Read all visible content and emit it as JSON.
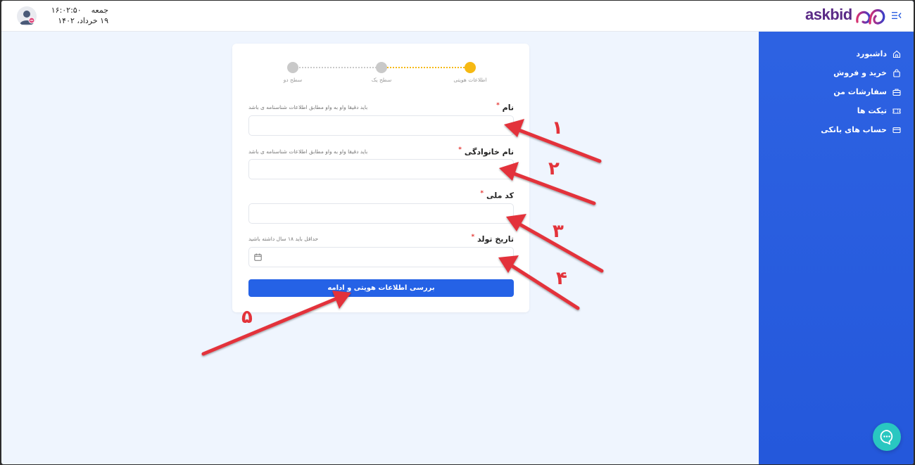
{
  "header": {
    "day": "جمعه",
    "time": "۱۶:۰۲:۵۰",
    "date": "۱۹ خرداد، ۱۴۰۲"
  },
  "brand": {
    "name": "askbid"
  },
  "sidebar": {
    "items": [
      {
        "label": "داشبورد",
        "icon": "home-icon"
      },
      {
        "label": "خرید و فروش",
        "icon": "bag-icon"
      },
      {
        "label": "سفارشات من",
        "icon": "briefcase-icon"
      },
      {
        "label": "تیکت ها",
        "icon": "ticket-icon"
      },
      {
        "label": "حساب های بانکی",
        "icon": "card-icon"
      }
    ]
  },
  "stepper": {
    "steps": [
      {
        "label": "اطلاعات هویتی",
        "state": "active"
      },
      {
        "label": "سطح یک",
        "state": "inactive"
      },
      {
        "label": "سطح دو",
        "state": "inactive"
      }
    ]
  },
  "form": {
    "first_name": {
      "label": "نام",
      "hint": "باید دقیقا واو به واو مطابق اطلاعات شناسنامه ی باشد",
      "value": ""
    },
    "last_name": {
      "label": "نام خانوادگی",
      "hint": "باید دقیقا واو به واو مطابق اطلاعات شناسنامه ی باشد",
      "value": ""
    },
    "national_code": {
      "label": "کد ملی",
      "value": ""
    },
    "birth_date": {
      "label": "تاریخ تولد",
      "hint": "حداقل باید ۱۸ سال داشته باشید",
      "value": ""
    },
    "required_mark": "*",
    "submit_label": "بررسی اطلاعات هویتی و ادامه"
  },
  "annotations": [
    "۱",
    "۲",
    "۳",
    "۴",
    "۵"
  ],
  "colors": {
    "accent": "#2562e6",
    "step_active": "#f6b913",
    "step_inactive": "#c9c9c9",
    "annotation": "#e3333a",
    "chat": "#29c7c1",
    "brand": "#5a2a86"
  }
}
